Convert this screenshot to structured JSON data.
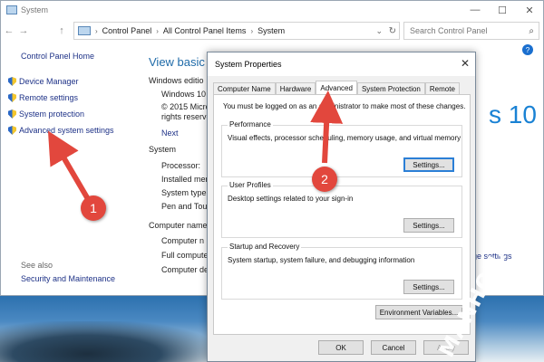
{
  "window": {
    "title": "System",
    "controls": {
      "minimize": "—",
      "maximize": "☐",
      "close": "✕"
    }
  },
  "address_bar": {
    "back": "←",
    "forward": "→",
    "up": "↑",
    "crumbs": [
      "Control Panel",
      "All Control Panel Items",
      "System"
    ],
    "dropdown": "⌄",
    "refresh": "↻",
    "search_placeholder": "Search Control Panel"
  },
  "help_icon": "?",
  "left_pane": {
    "home": "Control Panel Home",
    "items": [
      "Device Manager",
      "Remote settings",
      "System protection",
      "Advanced system settings"
    ],
    "see_also": "See also",
    "security": "Security and Maintenance"
  },
  "main": {
    "heading": "View basic in",
    "edition_label": "Windows editio",
    "edition_lines": [
      "Windows 10",
      "© 2015 Micro",
      "rights reserve"
    ],
    "next": "Next",
    "system_label": "System",
    "system_rows": [
      "Processor:",
      "Installed mer",
      "System type:",
      "Pen and Tou"
    ],
    "computer_label": "Computer name",
    "computer_rows": [
      "Computer n",
      "Full compute",
      "Computer de"
    ],
    "logo_text": "s 10",
    "change_settings": "ge settings"
  },
  "dialog": {
    "title": "System Properties",
    "close": "✕",
    "tabs": [
      "Computer Name",
      "Hardware",
      "Advanced",
      "System Protection",
      "Remote"
    ],
    "active_tab": "Advanced",
    "note": "You must be logged on as an administrator to make most of these changes.",
    "groups": [
      {
        "label": "Performance",
        "desc": "Visual effects, processor scheduling, memory usage, and virtual memory",
        "button": "Settings..."
      },
      {
        "label": "User Profiles",
        "desc": "Desktop settings related to your sign-in",
        "button": "Settings..."
      },
      {
        "label": "Startup and Recovery",
        "desc": "System startup, system failure, and debugging information",
        "button": "Settings..."
      }
    ],
    "env_button": "Environment Variables...",
    "ok": "OK",
    "cancel": "Cancel",
    "apply": "Apply"
  },
  "annotations": {
    "step1": "1",
    "step2": "2",
    "arrow_color": "#e2473d"
  },
  "watermark": "MANHQUAN.GA"
}
